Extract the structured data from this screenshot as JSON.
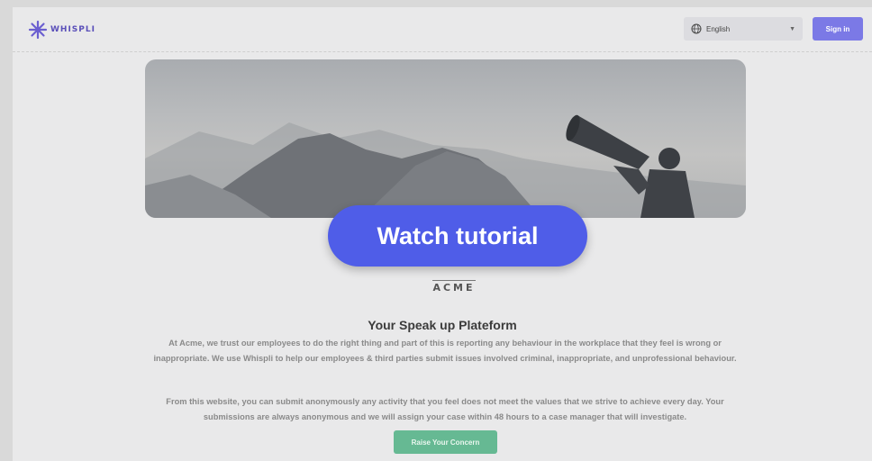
{
  "brand": {
    "name": "WHISPLI",
    "accent": "#5a4fb9"
  },
  "header": {
    "language": {
      "selected": "English",
      "icon": "globe-icon"
    },
    "signin_label": "Sign in"
  },
  "hero": {
    "alt_icon": "megaphone-icon"
  },
  "tutorial_label": "Watch tutorial",
  "company": {
    "logo_text": "ACME"
  },
  "main": {
    "headline": "Your Speak up Plateform",
    "paragraph1": "At Acme, we trust our employees to do the right thing and part of this is reporting any behaviour in the workplace that they feel is wrong or inappropriate. We use Whispli to help our employees & third parties submit issues involved criminal, inappropriate, and unprofessional behaviour.",
    "paragraph2": "From this website, you can submit anonymously any activity that you feel does not meet the values that we strive to achieve every day. Your submissions are always anonymous and we will assign your case within 48 hours to a case manager that will investigate.",
    "raise_label": "Raise Your Concern"
  },
  "colors": {
    "signin": "#7b79e6",
    "tutorial": "#4f5de8",
    "raise": "#66b993"
  }
}
